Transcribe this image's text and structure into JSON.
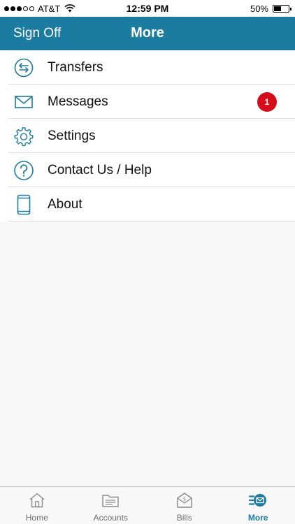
{
  "status_bar": {
    "carrier": "AT&T",
    "time": "12:59 PM",
    "battery_percent": "50%",
    "battery_level": 0.5,
    "signal_bars_filled": 3,
    "signal_bars_total": 5
  },
  "nav": {
    "left_button": "Sign Off",
    "title": "More"
  },
  "menu": {
    "items": [
      {
        "label": "Transfers",
        "icon": "transfer-arrows-icon"
      },
      {
        "label": "Messages",
        "icon": "envelope-icon",
        "badge": "1"
      },
      {
        "label": "Settings",
        "icon": "gear-icon"
      },
      {
        "label": "Contact Us / Help",
        "icon": "question-circle-icon"
      },
      {
        "label": "About",
        "icon": "phone-device-icon"
      }
    ]
  },
  "tab_bar": {
    "active": "More",
    "tabs": [
      {
        "label": "Home",
        "icon": "home-icon"
      },
      {
        "label": "Accounts",
        "icon": "folder-icon"
      },
      {
        "label": "Bills",
        "icon": "bill-envelope-icon"
      },
      {
        "label": "More",
        "icon": "more-menu-icon"
      }
    ]
  },
  "colors": {
    "brand": "#1b7ba0",
    "badge": "#d50d1b",
    "tab_inactive": "#6e6e6e",
    "background": "#f7f7f7"
  }
}
